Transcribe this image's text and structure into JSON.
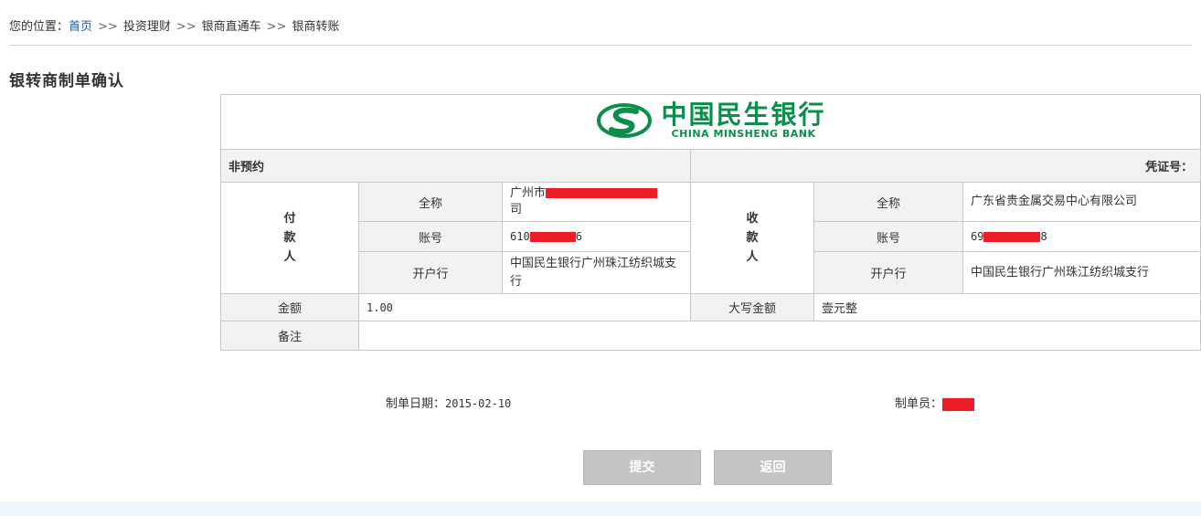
{
  "breadcrumb": {
    "label": "您的位置：",
    "home": "首页",
    "sep": ">>",
    "items": [
      "投资理财",
      "银商直通车",
      "银商转账"
    ]
  },
  "page_title": "银转商制单确认",
  "bank": {
    "name_cn": "中国民生银行",
    "name_en": "CHINA MINSHENG BANK",
    "brand_color": "#0a8f4a"
  },
  "voucher": {
    "left_label": "非预约",
    "right_label": "凭证号：",
    "payer": {
      "title": [
        "付",
        "款",
        "人"
      ],
      "fullname_label": "全称",
      "fullname": "广州市",
      "fullname_tail": "司",
      "account_label": "账号",
      "account": "610",
      "account_tail": "6",
      "bank_label": "开户行",
      "bank": "中国民生银行广州珠江纺织城支行"
    },
    "payee": {
      "title": [
        "收",
        "款",
        "人"
      ],
      "fullname_label": "全称",
      "fullname": "广东省贵金属交易中心有限公司",
      "account_label": "账号",
      "account": "69",
      "account_tail": "8",
      "bank_label": "开户行",
      "bank": "中国民生银行广州珠江纺织城支行"
    },
    "amount_label": "金额",
    "amount": "1.00",
    "amount_cap_label": "大写金额",
    "amount_cap": "壹元整",
    "remark_label": "备注",
    "remark": ""
  },
  "footer": {
    "date_label": "制单日期：",
    "date": "2015-02-10",
    "maker_label": "制单员："
  },
  "buttons": {
    "submit": "提交",
    "back": "返回"
  },
  "colors": {
    "link": "#1a5fb4",
    "redaction": "#ee1c25",
    "button": "#c4c4c4"
  }
}
